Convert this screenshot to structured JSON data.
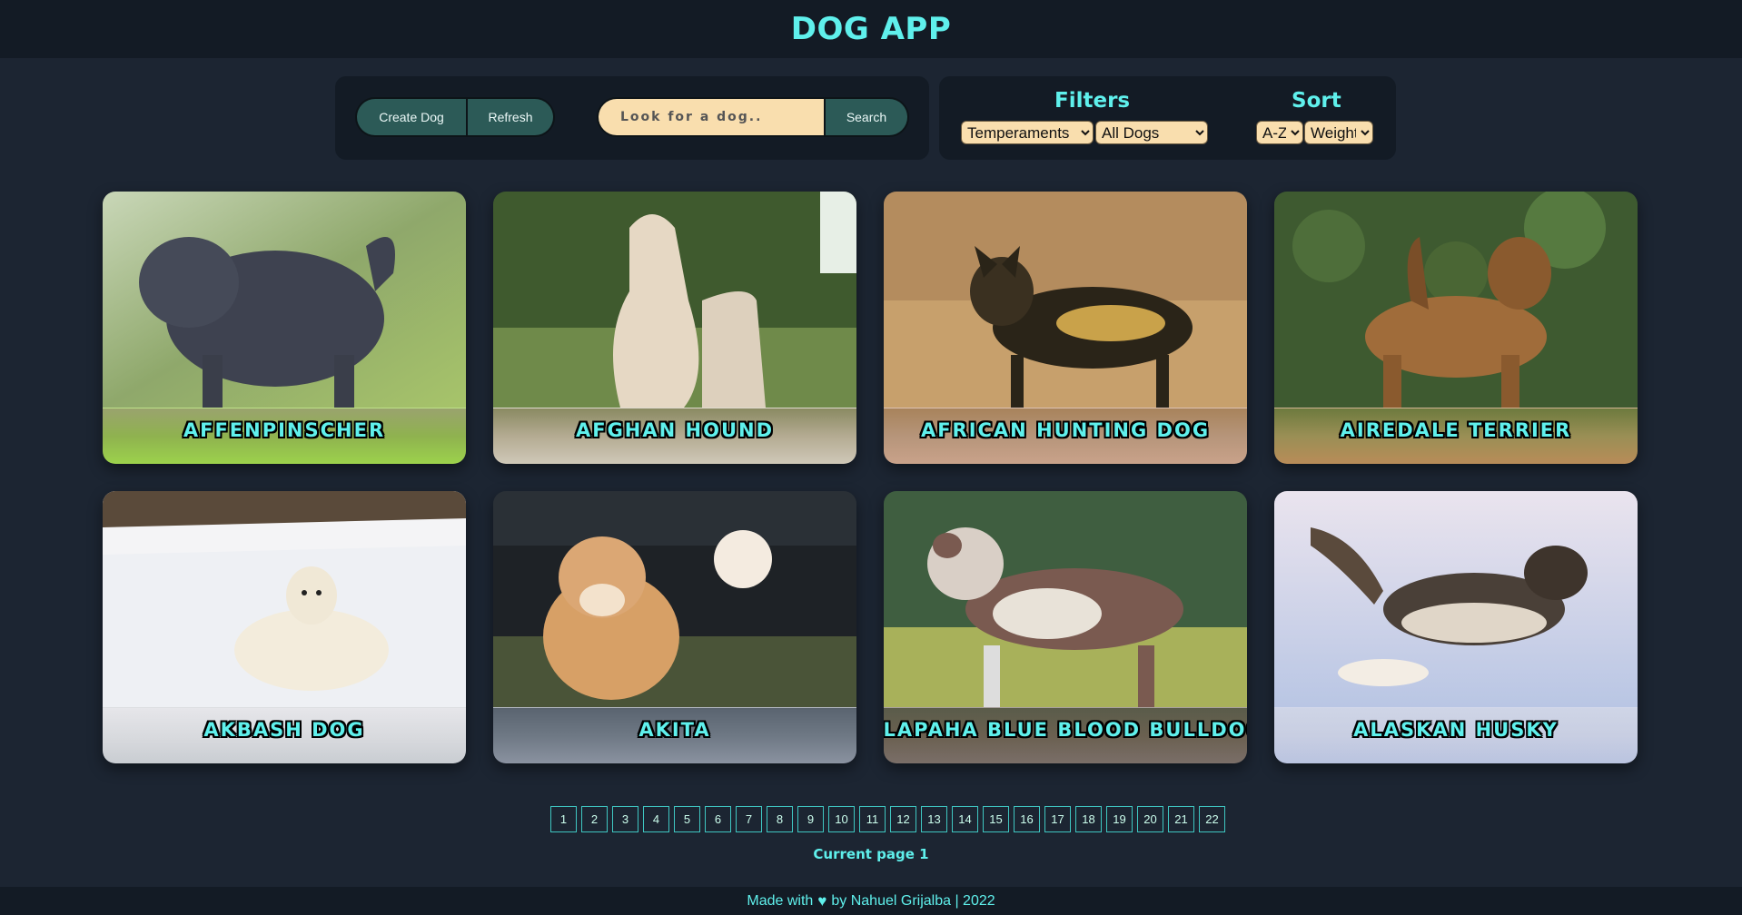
{
  "header": {
    "title": "DOG APP"
  },
  "toolbar": {
    "create_label": "Create Dog",
    "refresh_label": "Refresh",
    "search_placeholder": "Look for a dog..",
    "search_value": "",
    "search_label": "Search"
  },
  "controls": {
    "filters_title": "Filters",
    "sort_title": "Sort",
    "temperaments_selected": "Temperaments",
    "source_selected": "All Dogs",
    "order_selected": "A-Z",
    "sortby_selected": "Weight"
  },
  "cards": [
    {
      "name": "Affenpinscher"
    },
    {
      "name": "Afghan Hound"
    },
    {
      "name": "African Hunting Dog"
    },
    {
      "name": "Airedale Terrier"
    },
    {
      "name": "Akbash Dog"
    },
    {
      "name": "Akita"
    },
    {
      "name": "Alapaha Blue Blood Bulldog"
    },
    {
      "name": "Alaskan Husky"
    }
  ],
  "pagination": {
    "pages": [
      "1",
      "2",
      "3",
      "4",
      "5",
      "6",
      "7",
      "8",
      "9",
      "10",
      "11",
      "12",
      "13",
      "14",
      "15",
      "16",
      "17",
      "18",
      "19",
      "20",
      "21",
      "22"
    ],
    "current_label": "Current page 1",
    "current": 1
  },
  "footer": {
    "made_with": "Made with",
    "icon": "heart-icon",
    "by_text": "by Nahuel Grijalba | 2022"
  },
  "colors": {
    "accent": "#5ff0ec",
    "background": "#1c2532",
    "bar": "#131b25",
    "button": "#2c5a57",
    "input": "#f9deae"
  }
}
